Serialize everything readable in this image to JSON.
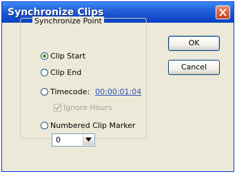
{
  "window": {
    "title": "Synchronize Clips",
    "close_icon": "close-icon"
  },
  "group": {
    "label": "Synchronize Point"
  },
  "options": {
    "clip_start": {
      "label": "Clip Start",
      "selected": true
    },
    "clip_end": {
      "label": "Clip End",
      "selected": false
    },
    "timecode": {
      "label": "Timecode:",
      "value": "00:00:01:04",
      "selected": false
    },
    "ignore_hours": {
      "label": "Ignore Hours",
      "checked": true,
      "disabled": true
    },
    "numbered_marker": {
      "label": "Numbered Clip Marker",
      "selected": false
    }
  },
  "marker_select": {
    "value": "0",
    "icon": "dropdown-arrow-icon"
  },
  "buttons": {
    "ok": "OK",
    "cancel": "Cancel"
  },
  "colors": {
    "title_bar": "#0a3fc4",
    "close_button": "#c2401c",
    "radio_selected": "#21a121",
    "timecode_link": "#2b4fb8"
  }
}
